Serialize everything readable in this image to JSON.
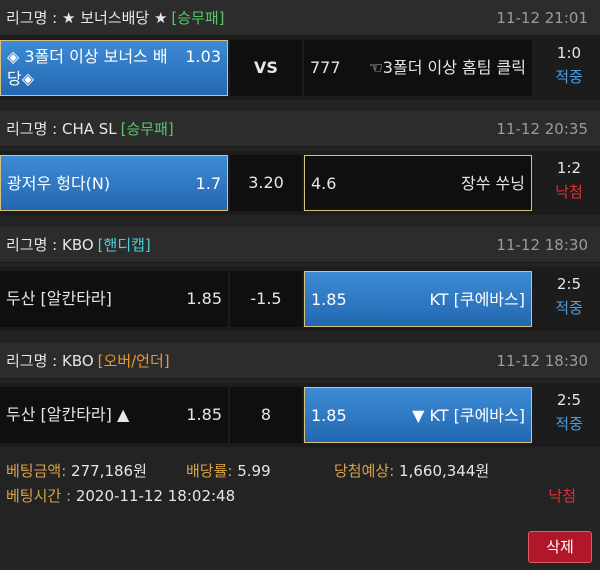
{
  "colors": {
    "type_green": "#55c76a",
    "type_cyan": "#4fd0d8",
    "type_orange": "#e89a2c",
    "result_hit": "#4a9ee6",
    "result_miss": "#e0303a",
    "selected_blue": "#2f7bc8",
    "gold_border": "#d8c27a"
  },
  "bets": [
    {
      "league_label": "리그명 : ★ 보너스배당 ★",
      "bet_type": "[승무패]",
      "datetime": "11-12 21:01",
      "home_team": "◈ 3폴더 이상 보너스 배당◈",
      "home_odds": "1.03",
      "middle": "VS",
      "away_odds": "777",
      "away_team": "☜3폴더 이상 홈팀 클릭",
      "score": "1:0",
      "result": "적중"
    },
    {
      "league_label": "리그명 : CHA SL",
      "bet_type": "[승무패]",
      "datetime": "11-12 20:35",
      "home_team": "광저우 헝다(N)",
      "home_odds": "1.7",
      "middle": "3.20",
      "away_odds": "4.6",
      "away_team": "장쑤 쑤닝",
      "score": "1:2",
      "result": "낙첨"
    },
    {
      "league_label": "리그명 : KBO",
      "bet_type": "[핸디캡]",
      "datetime": "11-12 18:30",
      "home_team": "두산 [알칸타라]",
      "home_odds": "1.85",
      "middle": "-1.5",
      "away_odds": "1.85",
      "away_team": "KT [쿠에바스]",
      "score": "2:5",
      "result": "적중"
    },
    {
      "league_label": "리그명 : KBO",
      "bet_type": "[오버/언더]",
      "datetime": "11-12 18:30",
      "home_team": "두산 [알칸타라] ▲",
      "home_odds": "1.85",
      "middle": "8",
      "away_odds": "1.85",
      "away_team": "▼ KT [쿠에바스]",
      "score": "2:5",
      "result": "적중"
    }
  ],
  "summary": {
    "bet_amount_label": "베팅금액:",
    "bet_amount": "277,186원",
    "odds_label": "배당률:",
    "odds": "5.99",
    "expected_win_label": "당첨예상:",
    "expected_win": "1,660,344원",
    "bet_time_label": "베팅시간 :",
    "bet_time": "2020-11-12 18:02:48",
    "overall_result": "낙첨"
  },
  "delete_button": "삭제"
}
